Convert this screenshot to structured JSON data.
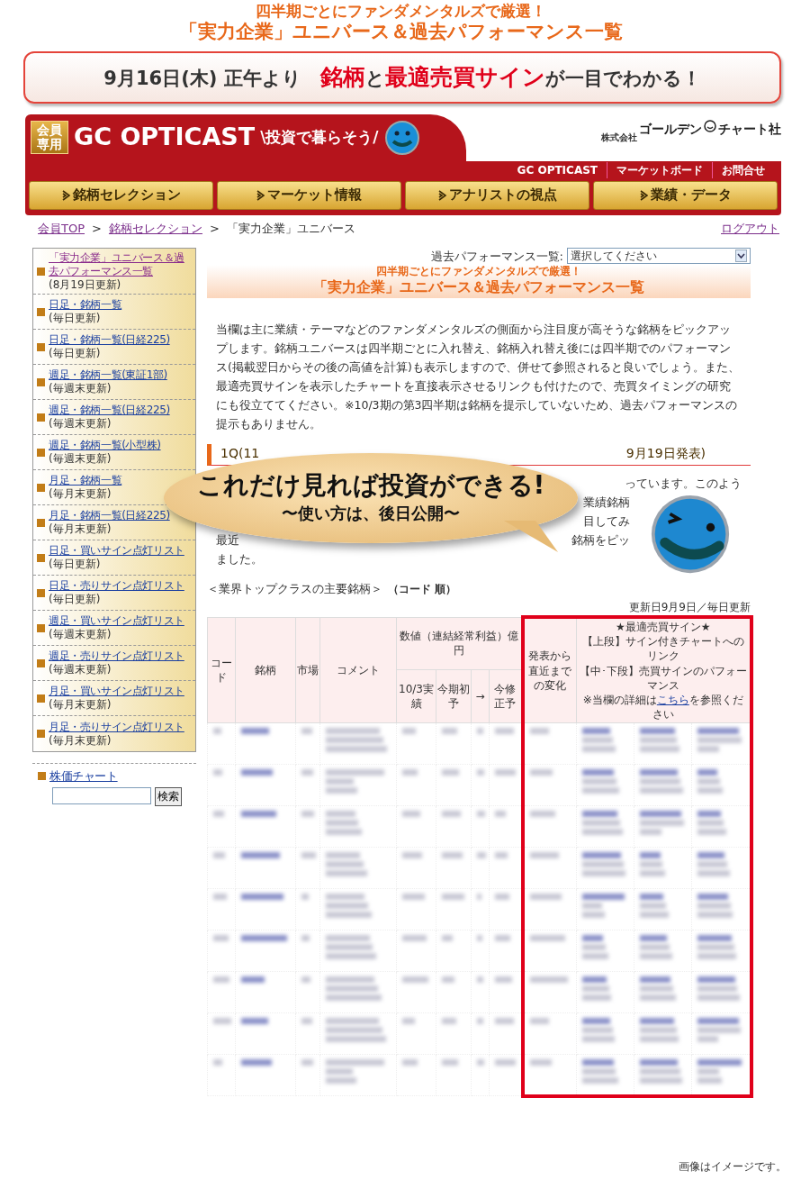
{
  "promo": {
    "subtitle": "四半期ごとにファンダメンタルズで厳選！",
    "title": "「実力企業」ユニバース＆過去パフォーマンス一覧",
    "banner_parts": [
      {
        "text": "9月16日(木) 正午より",
        "kind": "plain"
      },
      {
        "text": "銘柄",
        "kind": "highlight"
      },
      {
        "text": "と",
        "kind": "plain"
      },
      {
        "text": "最適売買サイン",
        "kind": "highlight"
      },
      {
        "text": "が一目でわかる！",
        "kind": "plain"
      }
    ]
  },
  "header": {
    "badge": "会員専用",
    "logo": "GC OPTICAST",
    "tagline": "\\投資で暮らそう/",
    "company_prefix": "株式会社",
    "company_left": "ゴールデン",
    "company_right": "チャート社",
    "links": [
      "GC OPTICAST",
      "マーケットボード",
      "お問合せ"
    ],
    "nav": [
      "銘柄セレクション",
      "マーケット情報",
      "アナリストの視点",
      "業績・データ"
    ]
  },
  "breadcrumb": {
    "items": [
      {
        "text": "会員TOP",
        "kind": "link"
      },
      {
        "text": ">",
        "kind": "separator"
      },
      {
        "text": "銘柄セレクション",
        "kind": "link"
      },
      {
        "text": ">",
        "kind": "separator"
      },
      {
        "text": "「実力企業」ユニバース",
        "kind": "current"
      }
    ],
    "logout": "ログアウト"
  },
  "sidebar": {
    "items": [
      {
        "title": "「実力企業」ユニバース＆過去パフォーマンス一覧",
        "note": "(8月19日更新)",
        "visited": true
      },
      {
        "title": "日足・銘柄一覧",
        "note": "(毎日更新)",
        "visited": false
      },
      {
        "title": "日足・銘柄一覧(日経225)",
        "note": "(毎日更新)",
        "visited": false
      },
      {
        "title": "週足・銘柄一覧(東証1部)",
        "note": "(毎週末更新)",
        "visited": false
      },
      {
        "title": "週足・銘柄一覧(日経225)",
        "note": "(毎週末更新)",
        "visited": false
      },
      {
        "title": "週足・銘柄一覧(小型株)",
        "note": "(毎週末更新)",
        "visited": false
      },
      {
        "title": "月足・銘柄一覧",
        "note": "(毎月末更新)",
        "visited": false
      },
      {
        "title": "月足・銘柄一覧(日経225)",
        "note": "(毎月末更新)",
        "visited": false
      },
      {
        "title": "日足・買いサイン点灯リスト",
        "note": "(毎日更新)",
        "visited": false
      },
      {
        "title": "日足・売りサイン点灯リスト",
        "note": "(毎日更新)",
        "visited": false
      },
      {
        "title": "週足・買いサイン点灯リスト",
        "note": "(毎週末更新)",
        "visited": false
      },
      {
        "title": "週足・売りサイン点灯リスト",
        "note": "(毎週末更新)",
        "visited": false
      },
      {
        "title": "月足・買いサイン点灯リスト",
        "note": "(毎月末更新)",
        "visited": false
      },
      {
        "title": "月足・売りサイン点灯リスト",
        "note": "(毎月末更新)",
        "visited": false
      }
    ],
    "chart_link": "株価チャート",
    "search_button": "検索"
  },
  "main": {
    "select_label": "過去パフォーマンス一覧:",
    "select_value": "選択してください",
    "heading_subtitle": "四半期ごとにファンダメンタルズで厳選！",
    "heading_title": "「実力企業」ユニバース＆過去パフォーマンス一覧",
    "intro": "当欄は主に業績・テーマなどのファンダメンタルズの側面から注目度が高そうな銘柄をピックアップします。銘柄ユニバースは四半期ごとに入れ替え、銘柄入れ替え後には四半期でのパフォーマンス(掲載翌日からその後の高値を計算)も表示しますので、併せて参照されると良いでしょう。また、最適売買サインを表示したチャートを直接表示させるリンクも付けたので、売買タイミングの研究にも役立ててください。※10/3期の第3四半期は銘柄を提示していないため、過去パフォーマンスの提示もありません。",
    "section_heading_start": "1Q(11",
    "section_heading_end": "9月19日発表)",
    "fragments": [
      {
        "right": "っています。このよう"
      },
      {
        "right": "業績銘柄"
      },
      {
        "right": "目してみ"
      },
      {
        "left": "最近",
        "right": "銘柄をピッ"
      },
      {
        "left": "ました。"
      }
    ],
    "list_title": "＜業界トップクラスの主要銘柄＞",
    "list_order": "（コード 順）",
    "updated": "更新日9月9日／毎日更新"
  },
  "table": {
    "columns": [
      "コード",
      "銘柄",
      "市場",
      "コメント"
    ],
    "group_header": "数値（連結経常利益）億円",
    "sub_columns": [
      "10/3実績",
      "今期初予",
      "→",
      "今修正予"
    ],
    "change_column": "発表から直近までの変化",
    "sign_header": {
      "lines": [
        "★最適売買サイン★",
        "【上段】サイン付きチャートへのリンク",
        "【中･下段】売買サインのパフォーマンス"
      ],
      "note_before": "※当欄の詳細は",
      "note_link": "こちら",
      "note_after": "を参照ください"
    }
  },
  "callout": {
    "title": "これだけ見れば投資ができる!",
    "subtitle": "〜使い方は、後日公開〜"
  },
  "footer_note": "画像はイメージです。"
}
